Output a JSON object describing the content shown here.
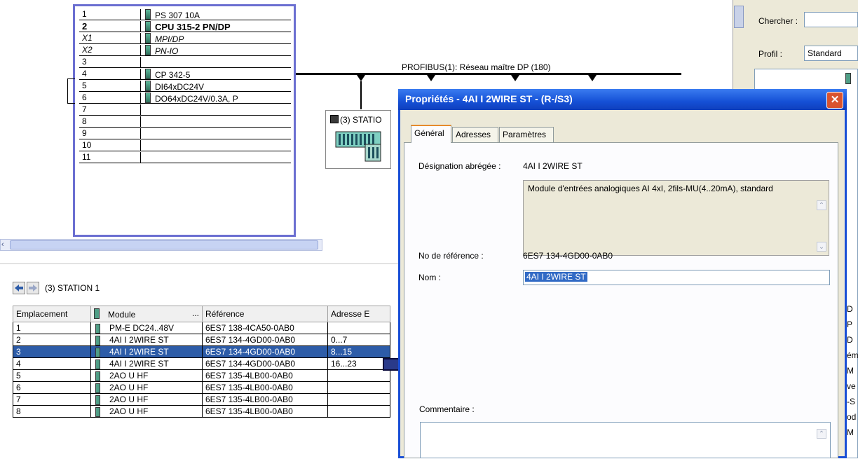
{
  "rack": {
    "rows": [
      {
        "slot": "1",
        "module": "PS 307 10A",
        "style": ""
      },
      {
        "slot": "2",
        "module": "CPU 315-2 PN/DP",
        "style": "bold"
      },
      {
        "slot": "X1",
        "module": "MPI/DP",
        "style": "ital"
      },
      {
        "slot": "X2",
        "module": "PN-IO",
        "style": "ital"
      },
      {
        "slot": "3",
        "module": "",
        "style": ""
      },
      {
        "slot": "4",
        "module": "CP 342-5",
        "style": ""
      },
      {
        "slot": "5",
        "module": "DI64xDC24V",
        "style": ""
      },
      {
        "slot": "6",
        "module": "DO64xDC24V/0.3A, P",
        "style": ""
      },
      {
        "slot": "7",
        "module": "",
        "style": ""
      },
      {
        "slot": "8",
        "module": "",
        "style": ""
      },
      {
        "slot": "9",
        "module": "",
        "style": ""
      },
      {
        "slot": "10",
        "module": "",
        "style": ""
      },
      {
        "slot": "11",
        "module": "",
        "style": ""
      }
    ]
  },
  "network": {
    "profibus_label": "PROFIBUS(1): Réseau maître DP (180)",
    "station_label": "(3) STATIO"
  },
  "bottom": {
    "station_title": "(3)   STATION 1",
    "columns": [
      "Emplacement",
      "Module",
      "...",
      "Référence",
      "Adresse E"
    ],
    "rows": [
      {
        "slot": "1",
        "module": "PM-E DC24..48V",
        "ref": "6ES7 138-4CA50-0AB0",
        "addr": "",
        "selected": false
      },
      {
        "slot": "2",
        "module": "4AI I 2WIRE ST",
        "ref": "6ES7 134-4GD00-0AB0",
        "addr": "0...7",
        "selected": false
      },
      {
        "slot": "3",
        "module": "4AI I 2WIRE ST",
        "ref": "6ES7 134-4GD00-0AB0",
        "addr": "8...15",
        "selected": true
      },
      {
        "slot": "4",
        "module": "4AI I 2WIRE ST",
        "ref": "6ES7 134-4GD00-0AB0",
        "addr": "16...23",
        "selected": false
      },
      {
        "slot": "5",
        "module": "2AO U HF",
        "ref": "6ES7 135-4LB00-0AB0",
        "addr": "",
        "selected": false
      },
      {
        "slot": "6",
        "module": "2AO U HF",
        "ref": "6ES7 135-4LB00-0AB0",
        "addr": "",
        "selected": false
      },
      {
        "slot": "7",
        "module": "2AO U HF",
        "ref": "6ES7 135-4LB00-0AB0",
        "addr": "",
        "selected": false
      },
      {
        "slot": "8",
        "module": "2AO U HF",
        "ref": "6ES7 135-4LB00-0AB0",
        "addr": "",
        "selected": false
      }
    ]
  },
  "dialog": {
    "title": "Propriétés - 4AI I 2WIRE ST - (R-/S3)",
    "close_glyph": "✕",
    "tabs": [
      "Général",
      "Adresses",
      "Paramètres"
    ],
    "short_label": "Désignation abrégée :",
    "short_value": "4AI I 2WIRE ST",
    "description": "Module d'entrées analogiques AI 4xI, 2fils-MU(4..20mA), standard",
    "ref_label": "No de référence :",
    "ref_value": "6ES7 134-4GD00-0AB0",
    "name_label": "Nom :",
    "name_value": "4AI I 2WIRE ST",
    "comment_label": "Commentaire :"
  },
  "catalog": {
    "search_label": "Chercher :",
    "profile_label": "Profil :",
    "profile_value": "Standard",
    "edge_text": [
      "D",
      "P",
      "D",
      "ém",
      "M",
      "ve",
      "-S",
      "od",
      "M"
    ]
  },
  "scroll_glyph_up": "⌃",
  "scroll_glyph_down": "⌄",
  "colors": {
    "selection": "#2d5ca8",
    "titlebar": "#1550d6",
    "rack_border": "#6b6fd1"
  }
}
